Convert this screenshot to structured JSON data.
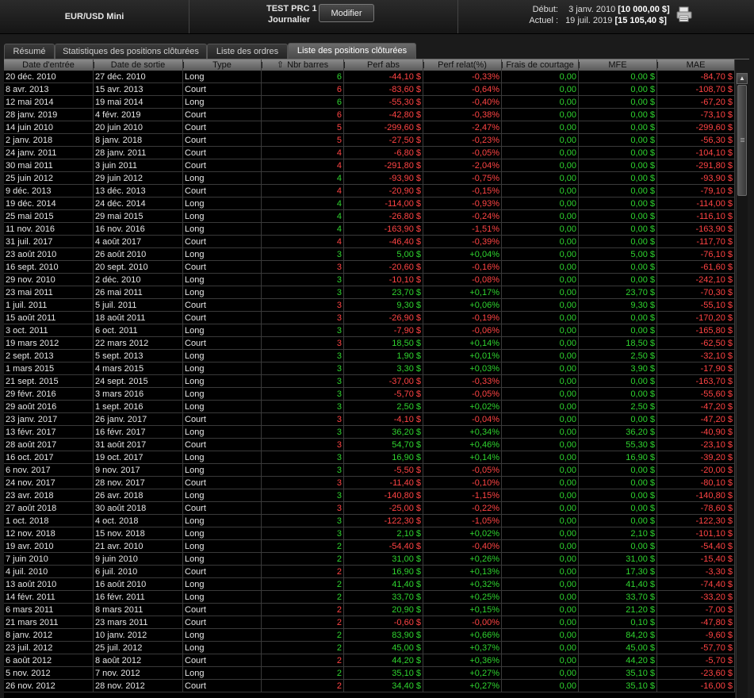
{
  "header": {
    "instrument": "EUR/USD Mini",
    "strategy": "TEST PRC 1",
    "timeframe": "Journalier",
    "modify_label": "Modifier",
    "start_label": "Début:",
    "start_date": "3 janv. 2010",
    "start_capital": "[10 000,00 $]",
    "current_label": "Actuel :",
    "current_date": "19 juil. 2019",
    "current_capital": "[15 105,40 $]",
    "print_icon": "printer-icon"
  },
  "tabs": [
    "Résumé",
    "Statistiques des positions clôturées",
    "Liste des ordres",
    "Liste des positions clôturées"
  ],
  "active_tab": 3,
  "columns": [
    "Date d'entrée",
    "Date de sortie",
    "Type",
    "Nbr barres",
    "Perf abs",
    "Perf relat(%)",
    "Frais de courtage",
    "MFE",
    "MAE"
  ],
  "sort_icon": "sort-arrow-up-icon",
  "colors": {
    "positive": "#2fd42f",
    "negative": "#ff4444",
    "background": "#000000"
  },
  "rows": [
    [
      "20 déc. 2010",
      "27 déc. 2010",
      "Long",
      "6",
      "-44,10 $",
      "-0,33%",
      "0,00",
      "0,00 $",
      "-84,70 $"
    ],
    [
      "8 avr. 2013",
      "15 avr. 2013",
      "Court",
      "6",
      "-83,60 $",
      "-0,64%",
      "0,00",
      "0,00 $",
      "-108,70 $"
    ],
    [
      "12 mai 2014",
      "19 mai 2014",
      "Long",
      "6",
      "-55,30 $",
      "-0,40%",
      "0,00",
      "0,00 $",
      "-67,20 $"
    ],
    [
      "28 janv. 2019",
      "4 févr. 2019",
      "Court",
      "6",
      "-42,80 $",
      "-0,38%",
      "0,00",
      "0,00 $",
      "-73,10 $"
    ],
    [
      "14 juin 2010",
      "20 juin 2010",
      "Court",
      "5",
      "-299,60 $",
      "-2,47%",
      "0,00",
      "0,00 $",
      "-299,60 $"
    ],
    [
      "2 janv. 2018",
      "8 janv. 2018",
      "Court",
      "5",
      "-27,50 $",
      "-0,23%",
      "0,00",
      "0,00 $",
      "-56,30 $"
    ],
    [
      "24 janv. 2011",
      "28 janv. 2011",
      "Court",
      "4",
      "-6,80 $",
      "-0,05%",
      "0,00",
      "0,00 $",
      "-104,10 $"
    ],
    [
      "30 mai 2011",
      "3 juin 2011",
      "Court",
      "4",
      "-291,80 $",
      "-2,04%",
      "0,00",
      "0,00 $",
      "-291,80 $"
    ],
    [
      "25 juin 2012",
      "29 juin 2012",
      "Long",
      "4",
      "-93,90 $",
      "-0,75%",
      "0,00",
      "0,00 $",
      "-93,90 $"
    ],
    [
      "9 déc. 2013",
      "13 déc. 2013",
      "Court",
      "4",
      "-20,90 $",
      "-0,15%",
      "0,00",
      "0,00 $",
      "-79,10 $"
    ],
    [
      "19 déc. 2014",
      "24 déc. 2014",
      "Long",
      "4",
      "-114,00 $",
      "-0,93%",
      "0,00",
      "0,00 $",
      "-114,00 $"
    ],
    [
      "25 mai 2015",
      "29 mai 2015",
      "Long",
      "4",
      "-26,80 $",
      "-0,24%",
      "0,00",
      "0,00 $",
      "-116,10 $"
    ],
    [
      "11 nov. 2016",
      "16 nov. 2016",
      "Long",
      "4",
      "-163,90 $",
      "-1,51%",
      "0,00",
      "0,00 $",
      "-163,90 $"
    ],
    [
      "31 juil. 2017",
      "4 août 2017",
      "Court",
      "4",
      "-46,40 $",
      "-0,39%",
      "0,00",
      "0,00 $",
      "-117,70 $"
    ],
    [
      "23 août 2010",
      "26 août 2010",
      "Long",
      "3",
      "5,00 $",
      "+0,04%",
      "0,00",
      "5,00 $",
      "-76,10 $"
    ],
    [
      "16 sept. 2010",
      "20 sept. 2010",
      "Court",
      "3",
      "-20,60 $",
      "-0,16%",
      "0,00",
      "0,00 $",
      "-61,60 $"
    ],
    [
      "29 nov. 2010",
      "2 déc. 2010",
      "Long",
      "3",
      "-10,10 $",
      "-0,08%",
      "0,00",
      "0,00 $",
      "-242,10 $"
    ],
    [
      "23 mai 2011",
      "26 mai 2011",
      "Long",
      "3",
      "23,70 $",
      "+0,17%",
      "0,00",
      "23,70 $",
      "-70,30 $"
    ],
    [
      "1 juil. 2011",
      "5 juil. 2011",
      "Court",
      "3",
      "9,30 $",
      "+0,06%",
      "0,00",
      "9,30 $",
      "-55,10 $"
    ],
    [
      "15 août 2011",
      "18 août 2011",
      "Court",
      "3",
      "-26,90 $",
      "-0,19%",
      "0,00",
      "0,00 $",
      "-170,20 $"
    ],
    [
      "3 oct. 2011",
      "6 oct. 2011",
      "Long",
      "3",
      "-7,90 $",
      "-0,06%",
      "0,00",
      "0,00 $",
      "-165,80 $"
    ],
    [
      "19 mars 2012",
      "22 mars 2012",
      "Court",
      "3",
      "18,50 $",
      "+0,14%",
      "0,00",
      "18,50 $",
      "-62,50 $"
    ],
    [
      "2 sept. 2013",
      "5 sept. 2013",
      "Long",
      "3",
      "1,90 $",
      "+0,01%",
      "0,00",
      "2,50 $",
      "-32,10 $"
    ],
    [
      "1 mars 2015",
      "4 mars 2015",
      "Long",
      "3",
      "3,30 $",
      "+0,03%",
      "0,00",
      "3,90 $",
      "-17,90 $"
    ],
    [
      "21 sept. 2015",
      "24 sept. 2015",
      "Long",
      "3",
      "-37,00 $",
      "-0,33%",
      "0,00",
      "0,00 $",
      "-163,70 $"
    ],
    [
      "29 févr. 2016",
      "3 mars 2016",
      "Long",
      "3",
      "-5,70 $",
      "-0,05%",
      "0,00",
      "0,00 $",
      "-55,60 $"
    ],
    [
      "29 août 2016",
      "1 sept. 2016",
      "Long",
      "3",
      "2,50 $",
      "+0,02%",
      "0,00",
      "2,50 $",
      "-47,20 $"
    ],
    [
      "23 janv. 2017",
      "26 janv. 2017",
      "Court",
      "3",
      "-4,10 $",
      "-0,04%",
      "0,00",
      "0,00 $",
      "-47,20 $"
    ],
    [
      "13 févr. 2017",
      "16 févr. 2017",
      "Long",
      "3",
      "36,20 $",
      "+0,34%",
      "0,00",
      "36,20 $",
      "-40,90 $"
    ],
    [
      "28 août 2017",
      "31 août 2017",
      "Court",
      "3",
      "54,70 $",
      "+0,46%",
      "0,00",
      "55,30 $",
      "-23,10 $"
    ],
    [
      "16 oct. 2017",
      "19 oct. 2017",
      "Long",
      "3",
      "16,90 $",
      "+0,14%",
      "0,00",
      "16,90 $",
      "-39,20 $"
    ],
    [
      "6 nov. 2017",
      "9 nov. 2017",
      "Long",
      "3",
      "-5,50 $",
      "-0,05%",
      "0,00",
      "0,00 $",
      "-20,00 $"
    ],
    [
      "24 nov. 2017",
      "28 nov. 2017",
      "Court",
      "3",
      "-11,40 $",
      "-0,10%",
      "0,00",
      "0,00 $",
      "-80,10 $"
    ],
    [
      "23 avr. 2018",
      "26 avr. 2018",
      "Long",
      "3",
      "-140,80 $",
      "-1,15%",
      "0,00",
      "0,00 $",
      "-140,80 $"
    ],
    [
      "27 août 2018",
      "30 août 2018",
      "Court",
      "3",
      "-25,00 $",
      "-0,22%",
      "0,00",
      "0,00 $",
      "-78,60 $"
    ],
    [
      "1 oct. 2018",
      "4 oct. 2018",
      "Long",
      "3",
      "-122,30 $",
      "-1,05%",
      "0,00",
      "0,00 $",
      "-122,30 $"
    ],
    [
      "12 nov. 2018",
      "15 nov. 2018",
      "Long",
      "3",
      "2,10 $",
      "+0,02%",
      "0,00",
      "2,10 $",
      "-101,10 $"
    ],
    [
      "19 avr. 2010",
      "21 avr. 2010",
      "Long",
      "2",
      "-54,40 $",
      "-0,40%",
      "0,00",
      "0,00 $",
      "-54,40 $"
    ],
    [
      "7 juin 2010",
      "9 juin 2010",
      "Long",
      "2",
      "31,00 $",
      "+0,26%",
      "0,00",
      "31,00 $",
      "-15,40 $"
    ],
    [
      "4 juil. 2010",
      "6 juil. 2010",
      "Court",
      "2",
      "16,90 $",
      "+0,13%",
      "0,00",
      "17,30 $",
      "-3,30 $"
    ],
    [
      "13 août 2010",
      "16 août 2010",
      "Long",
      "2",
      "41,40 $",
      "+0,32%",
      "0,00",
      "41,40 $",
      "-74,40 $"
    ],
    [
      "14 févr. 2011",
      "16 févr. 2011",
      "Long",
      "2",
      "33,70 $",
      "+0,25%",
      "0,00",
      "33,70 $",
      "-33,20 $"
    ],
    [
      "6 mars 2011",
      "8 mars 2011",
      "Court",
      "2",
      "20,90 $",
      "+0,15%",
      "0,00",
      "21,20 $",
      "-7,00 $"
    ],
    [
      "21 mars 2011",
      "23 mars 2011",
      "Court",
      "2",
      "-0,60 $",
      "-0,00%",
      "0,00",
      "0,10 $",
      "-47,80 $"
    ],
    [
      "8 janv. 2012",
      "10 janv. 2012",
      "Long",
      "2",
      "83,90 $",
      "+0,66%",
      "0,00",
      "84,20 $",
      "-9,60 $"
    ],
    [
      "23 juil. 2012",
      "25 juil. 2012",
      "Long",
      "2",
      "45,00 $",
      "+0,37%",
      "0,00",
      "45,00 $",
      "-57,70 $"
    ],
    [
      "6 août 2012",
      "8 août 2012",
      "Court",
      "2",
      "44,20 $",
      "+0,36%",
      "0,00",
      "44,20 $",
      "-5,70 $"
    ],
    [
      "5 nov. 2012",
      "7 nov. 2012",
      "Long",
      "2",
      "35,10 $",
      "+0,27%",
      "0,00",
      "35,10 $",
      "-23,60 $"
    ],
    [
      "26 nov. 2012",
      "28 nov. 2012",
      "Court",
      "2",
      "34,40 $",
      "+0,27%",
      "0,00",
      "35,10 $",
      "-16,00 $"
    ]
  ]
}
